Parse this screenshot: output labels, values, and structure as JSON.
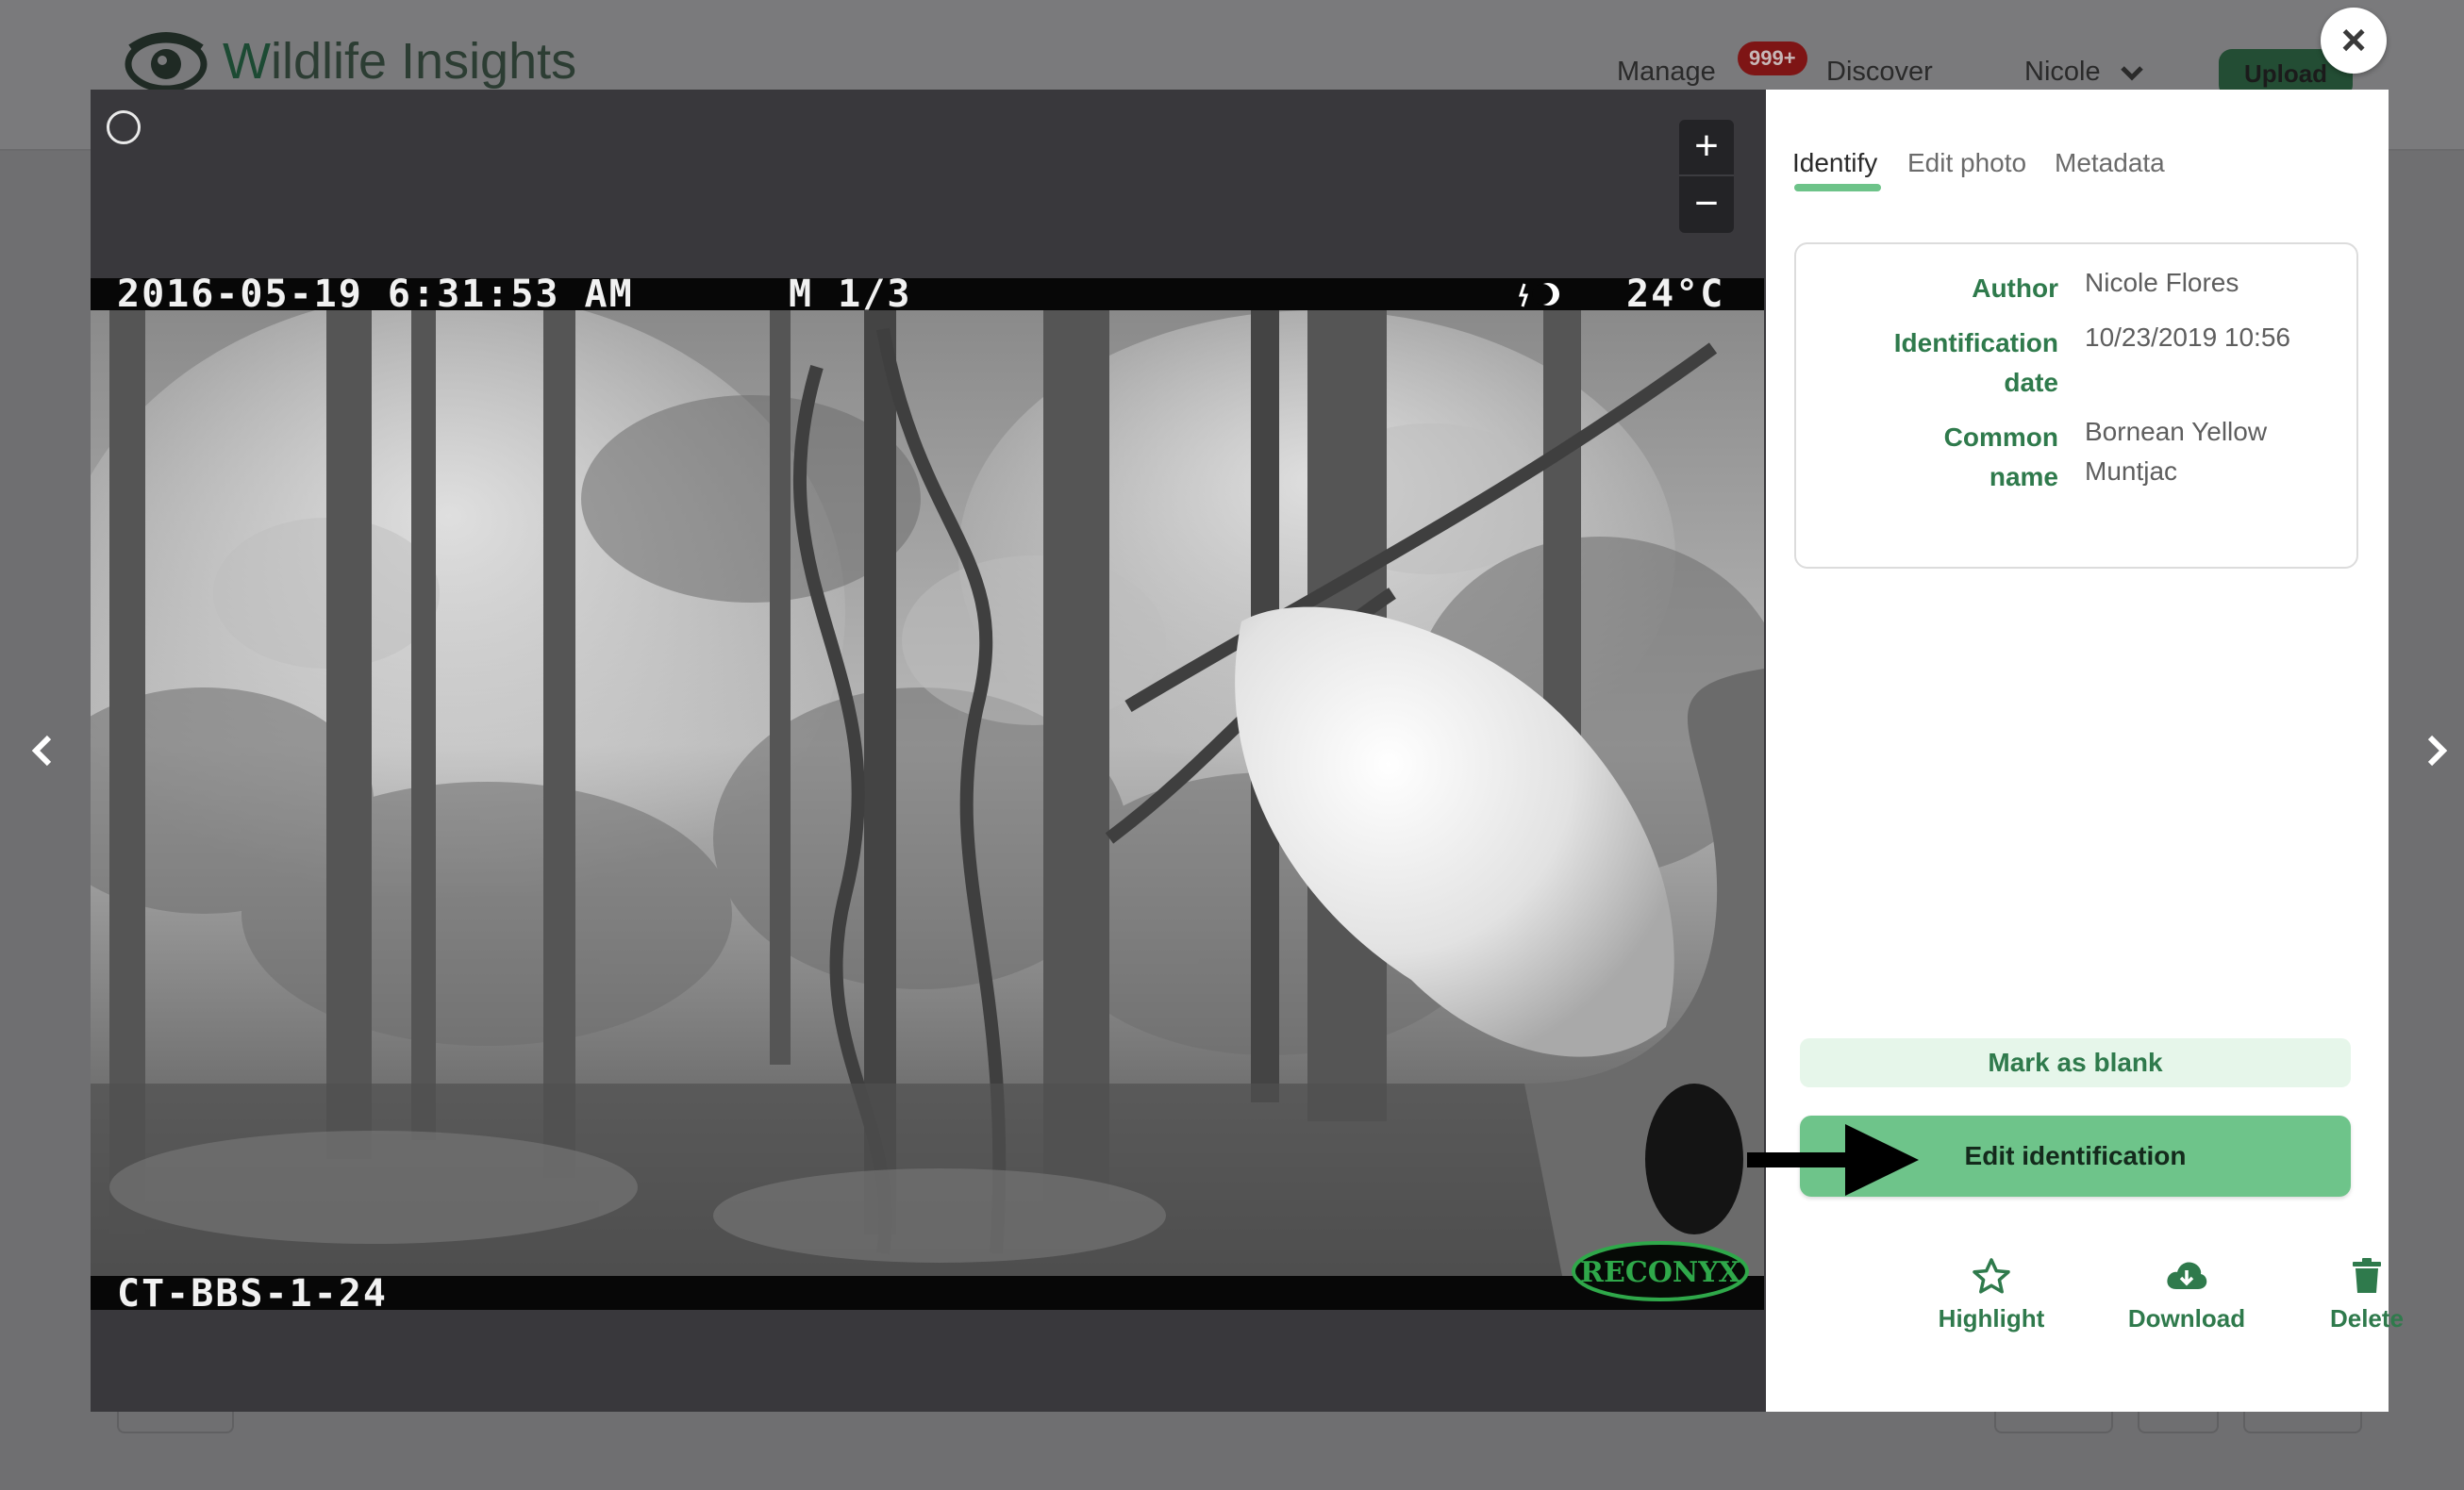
{
  "header": {
    "logo_text_w": "W",
    "logo_text_rest": "ildlife Insights",
    "nav": {
      "manage": "Manage",
      "badge": "999+",
      "discover": "Discover",
      "user": "Nicole",
      "upload": "Upload"
    }
  },
  "photo": {
    "overlay_datetime": "2016-05-19 6:31:53 AM",
    "overlay_sequence": "M 1/3",
    "overlay_temperature": "24°C",
    "overlay_camera": "CT-BBS-1-24",
    "watermark": "RECONYX"
  },
  "viewer": {
    "zoom_in": "+",
    "zoom_out": "−"
  },
  "tabs": [
    {
      "label": "Identify",
      "active": true
    },
    {
      "label": "Edit photo",
      "active": false
    },
    {
      "label": "Metadata",
      "active": false
    }
  ],
  "identification": {
    "author_label": "Author",
    "author_value": "Nicole Flores",
    "date_label_1": "Identification",
    "date_label_2": "date",
    "date_value": "10/23/2019 10:56",
    "common_label_1": "Common",
    "common_label_2": "name",
    "common_value_1": "Bornean Yellow",
    "common_value_2": "Muntjac"
  },
  "actions": {
    "mark_blank": "Mark as blank",
    "edit_identification": "Edit identification",
    "highlight": "Highlight",
    "download": "Download",
    "delete": "Delete"
  },
  "modal": {
    "close": "×"
  },
  "colors": {
    "accent": "#6ec48a",
    "accent_text": "#2f7a4c",
    "image_bg": "#39383c"
  }
}
